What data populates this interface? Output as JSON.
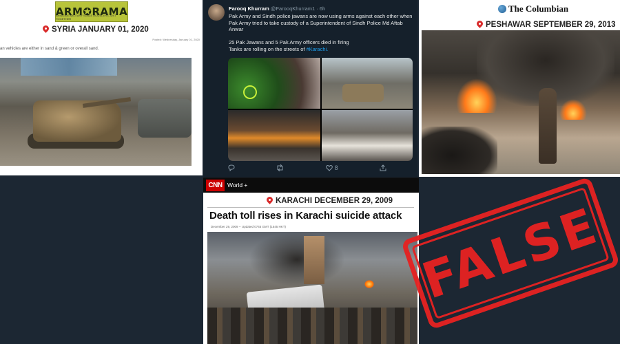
{
  "panel_armorama": {
    "logo": "ARM✪RAMA",
    "logo_sub": "BRINGING MILITARY SCALE MODELERS JUST TOGETHER",
    "caption": "SYRIA JANUARY 01, 2020",
    "posted": "Posted: Wednesday, January 01, 2020",
    "desc": "an vehicles are either in sand & green or overall sand."
  },
  "panel_tweet": {
    "name": "Farooq Khurram",
    "handle": "@FarooqKhurram1 · 6h",
    "text_1": "Pak Army and Sindh police jawans are now using arms against each other when Pak Army tried to take custody of a Superintendent of Sindh Police Md Aftab Anwar",
    "text_2": "25 Pak Jawans and 5 Pak Army officers died in firing",
    "text_3": "Tanks are rolling on the streets of",
    "hashtag": "#Karachi.",
    "likes": "8"
  },
  "panel_columbian": {
    "brand": "The Columbian",
    "caption": "PESHAWAR SEPTEMBER 29, 2013"
  },
  "panel_cnn": {
    "logo": "CNN",
    "section": "World +",
    "caption": "KARACHI DECEMBER 29, 2009",
    "headline": "Death toll rises in Karachi suicide attack",
    "dateline": "December 29, 2009 -- Updated 0745 GMT (1545 HKT)"
  },
  "stamp": {
    "label": "FALSE",
    "color": "#e52222"
  },
  "colors": {
    "background": "#1c2733",
    "pin": "#d92b2b",
    "link": "#1da1f2"
  }
}
